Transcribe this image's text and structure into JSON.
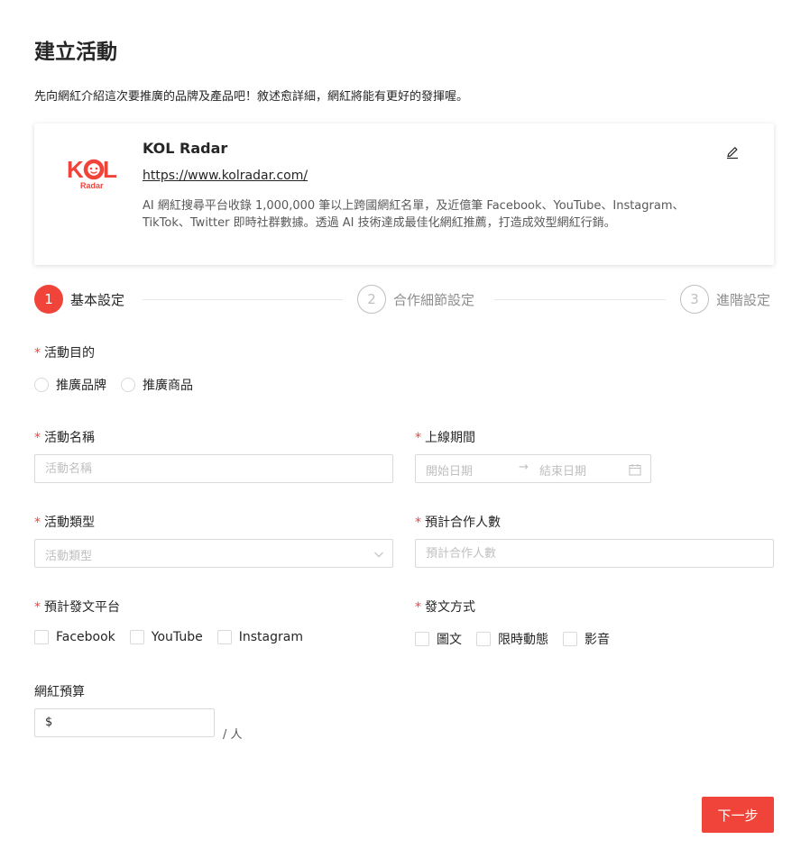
{
  "page": {
    "title": "建立活動",
    "description": "先向網紅介紹這次要推廣的品牌及產品吧！敘述愈詳細，網紅將能有更好的發揮喔。"
  },
  "brand": {
    "logo_text": "KOL",
    "logo_sub": "Radar",
    "name": "KOL Radar",
    "url": "https://www.kolradar.com/",
    "description": "AI 網紅搜尋平台收錄 1,000,000 筆以上跨國網紅名單，及近億筆 Facebook、YouTube、Instagram、TikTok、Twitter 即時社群數據。透過 AI 技術達成最佳化網紅推薦，打造成效型網紅行銷。",
    "edit_icon": "pencil-icon"
  },
  "steps": [
    {
      "number": "1",
      "label": "基本設定",
      "state": "active"
    },
    {
      "number": "2",
      "label": "合作細節設定",
      "state": "inactive"
    },
    {
      "number": "3",
      "label": "進階設定",
      "state": "inactive"
    }
  ],
  "form": {
    "required_mark": "*",
    "purpose": {
      "label": "活動目的",
      "options": [
        "推廣品牌",
        "推廣商品"
      ]
    },
    "name": {
      "label": "活動名稱",
      "placeholder": "活動名稱"
    },
    "period": {
      "label": "上線期間",
      "start_placeholder": "開始日期",
      "arrow": "→",
      "end_placeholder": "結束日期"
    },
    "type": {
      "label": "活動類型",
      "placeholder": "活動類型"
    },
    "count": {
      "label": "預計合作人數",
      "placeholder": "預計合作人數"
    },
    "platforms": {
      "label": "預計發文平台",
      "options": [
        "Facebook",
        "YouTube",
        "Instagram"
      ]
    },
    "post_type": {
      "label": "發文方式",
      "options": [
        "圖文",
        "限時動態",
        "影音"
      ]
    },
    "budget": {
      "label": "網紅預算",
      "currency": "$",
      "unit": "/ 人"
    }
  },
  "actions": {
    "next_label": "下一步"
  },
  "colors": {
    "accent": "#f0443a",
    "border": "#d9d9d9",
    "placeholder": "#bfbfbf"
  }
}
